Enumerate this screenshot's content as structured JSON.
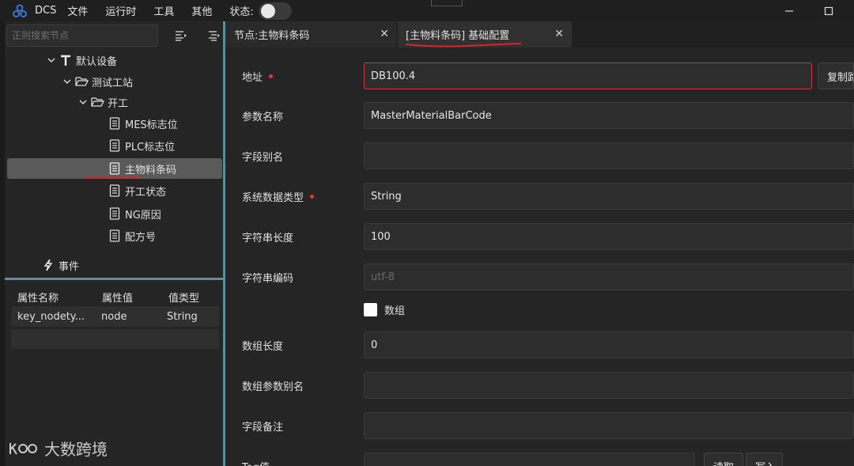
{
  "app": {
    "name": "DCS"
  },
  "menu": [
    "文件",
    "运行时",
    "工具",
    "其他"
  ],
  "status": {
    "label": "状态:",
    "toggle_on": false
  },
  "search": {
    "placeholder": "正则搜索节点"
  },
  "tree": [
    {
      "label": "默认设备",
      "icon": "text-t-icon",
      "depth": 0,
      "expanded": true
    },
    {
      "label": "测试工站",
      "icon": "folder-open-icon",
      "depth": 1,
      "expanded": true
    },
    {
      "label": "开工",
      "icon": "folder-open-icon",
      "depth": 2,
      "expanded": true
    },
    {
      "label": "MES标志位",
      "icon": "document-icon",
      "depth": 3
    },
    {
      "label": "PLC标志位",
      "icon": "document-icon",
      "depth": 3
    },
    {
      "label": "主物料条码",
      "icon": "document-icon",
      "depth": 3,
      "selected": true
    },
    {
      "label": "开工状态",
      "icon": "document-icon",
      "depth": 3
    },
    {
      "label": "NG原因",
      "icon": "document-icon",
      "depth": 3
    },
    {
      "label": "配方号",
      "icon": "document-icon",
      "depth": 3
    },
    {
      "label": "事件",
      "icon": "lightning-icon",
      "depth": -1
    }
  ],
  "properties": {
    "headers": [
      "属性名称",
      "属性值",
      "值类型"
    ],
    "rows": [
      [
        "key_nodety...",
        "node",
        "String"
      ]
    ]
  },
  "tabs": [
    {
      "label": "节点:主物料条码"
    },
    {
      "label": "[主物料条码] 基础配置",
      "active": true
    }
  ],
  "form": {
    "address": {
      "label": "地址",
      "value": "DB100.4",
      "required": true,
      "button": "复制路径"
    },
    "param_name": {
      "label": "参数名称",
      "value": "MasterMaterialBarCode"
    },
    "field_alias": {
      "label": "字段别名",
      "value": ""
    },
    "data_type": {
      "label": "系统数据类型",
      "value": "String",
      "required": true
    },
    "string_length": {
      "label": "字符串长度",
      "value": "100"
    },
    "string_encoding": {
      "label": "字符串编码",
      "placeholder": "utf-8"
    },
    "is_array": {
      "label": "数组",
      "checked": false
    },
    "array_length": {
      "label": "数组长度",
      "value": "0"
    },
    "array_alias": {
      "label": "数组参数别名",
      "value": ""
    },
    "field_note": {
      "label": "字段备注",
      "value": ""
    },
    "tag": {
      "label": "Tag值",
      "value": "",
      "read_button": "读取",
      "write_button": "写入"
    }
  },
  "watermark": {
    "text": "大数跨境"
  },
  "colors": {
    "accent": "#5a8f99",
    "required": "#e0363c",
    "error_border": "#c8383d",
    "annotation": "#d3262d"
  }
}
